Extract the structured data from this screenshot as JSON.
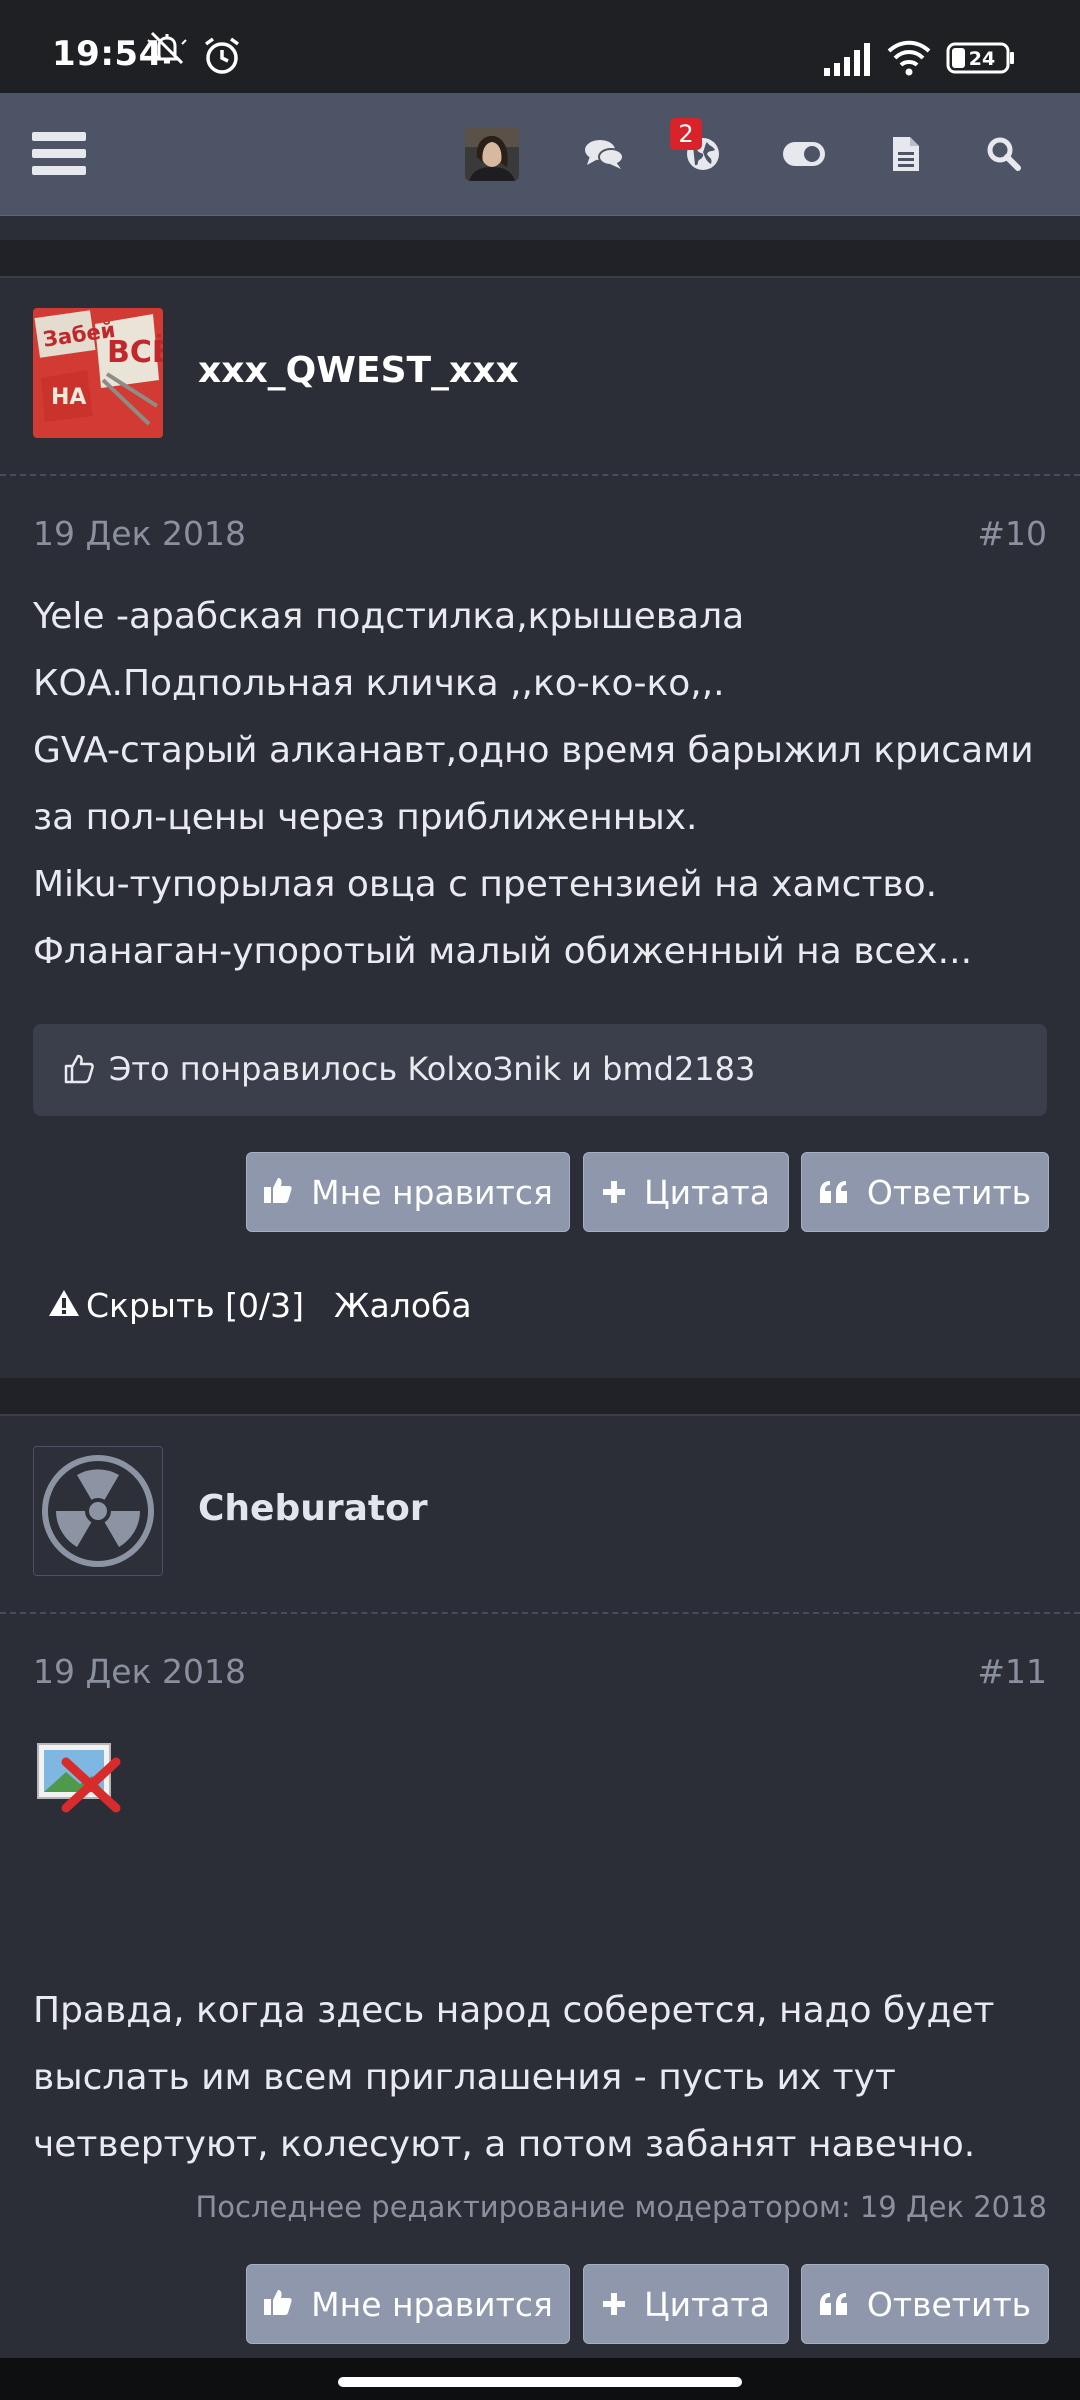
{
  "status_bar": {
    "time": "19:54",
    "battery": "24",
    "icons": [
      "mute-icon",
      "alarm-icon",
      "signal-icon",
      "wifi-icon",
      "battery-icon"
    ]
  },
  "top_nav": {
    "icons": [
      "menu-icon",
      "user-avatar",
      "chat-icon",
      "globe-icon",
      "toggle-icon",
      "document-icon",
      "search-icon"
    ],
    "notifications_badge": "2"
  },
  "posts": [
    {
      "username": "xxx_QWEST_xxx",
      "avatar_text": [
        "Забей",
        "НА",
        "ВСЁ"
      ],
      "date": "19 Дек 2018",
      "number": "#10",
      "lines": [
        "Yele -арабская подстилка,крышевала",
        "КОА.Подпольная кличка ,,ко-ко-ко,,.",
        "GVA-старый алканавт,одно время барыжил крисами",
        "за пол-цены через приближенных.",
        "Miku-тупорылая овца с претензией на хамство.",
        "Фланаган-упоротый малый обиженный на всех..."
      ],
      "likes_text": "Это понравилось KolxoЗnik и bmd2183",
      "buttons": {
        "like": "Мне нравится",
        "quote": "Цитата",
        "reply": "Ответить"
      },
      "actions": {
        "hide": "Скрыть [0/3]",
        "report": "Жалоба"
      }
    },
    {
      "username": "Cheburator",
      "date": "19 Дек 2018",
      "number": "#11",
      "lines": [
        "Правда, когда здесь народ соберется, надо будет",
        "выслать им всем приглашения - пусть их тут",
        "четвертуют, колесуют, а потом забанят навечно."
      ],
      "edit_note": "Последнее редактирование модератором: 19 Дек 2018",
      "buttons": {
        "like": "Мне нравится",
        "quote": "Цитата",
        "reply": "Ответить"
      }
    }
  ],
  "colors": {
    "background": "#2b2e36",
    "nav": "#4d5465",
    "button": "#8e97ac",
    "badge": "#d8232a",
    "muted_text": "#8a909e"
  }
}
